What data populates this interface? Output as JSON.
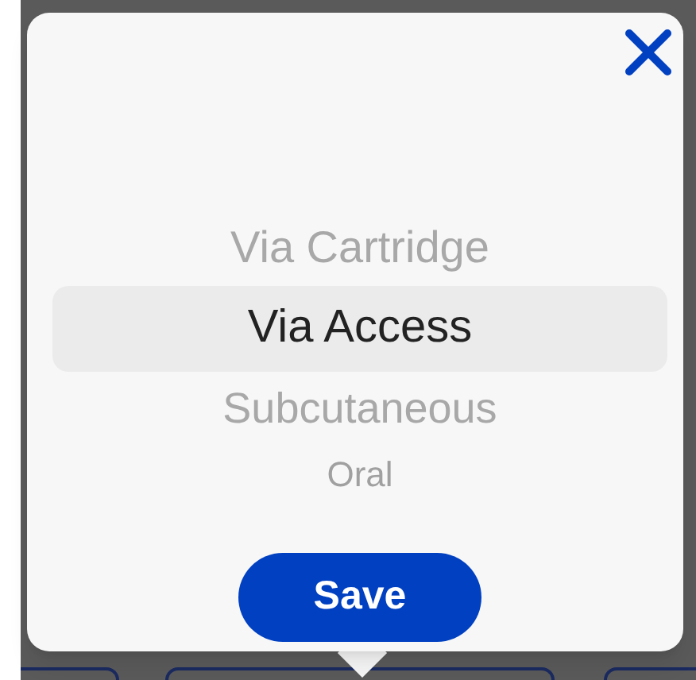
{
  "picker": {
    "options": [
      {
        "label": "Via Cartridge",
        "selected": false
      },
      {
        "label": "Via Access",
        "selected": true
      },
      {
        "label": "Subcutaneous",
        "selected": false
      },
      {
        "label": "Oral",
        "selected": false
      }
    ]
  },
  "save_button": {
    "label": "Save"
  }
}
